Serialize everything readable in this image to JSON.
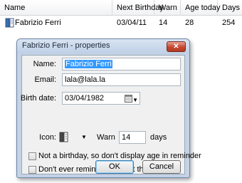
{
  "list": {
    "columns": [
      "Name",
      "Next Birthday",
      "Warn",
      "Age today",
      "Days"
    ],
    "rows": [
      {
        "name": "Fabrizio Ferri",
        "next_birthday": "03/04/11",
        "warn": "14",
        "age_today": "28",
        "days": "254",
        "icon": "book-icon"
      }
    ]
  },
  "dialog": {
    "title": "Fabrizio Ferri - properties",
    "close_label": "✕",
    "name_label": "Name:",
    "name_value": "Fabrizio Ferri",
    "email_label": "Email:",
    "email_value": "lala@lala.la",
    "birth_label": "Birth date:",
    "birth_value": "03/04/1982",
    "icon_label": "Icon:",
    "warn_label": "Warn",
    "warn_value": "14",
    "days_label": "days",
    "check_no_age": "Not a birthday, so don't display age in reminder",
    "check_no_remind": "Don't ever remind me about this",
    "ok_label": "OK",
    "cancel_label": "Cancel"
  },
  "colors": {
    "dialog_frame": "#c4d3e6",
    "close_button": "#c7472f",
    "selection": "#3399ff"
  }
}
